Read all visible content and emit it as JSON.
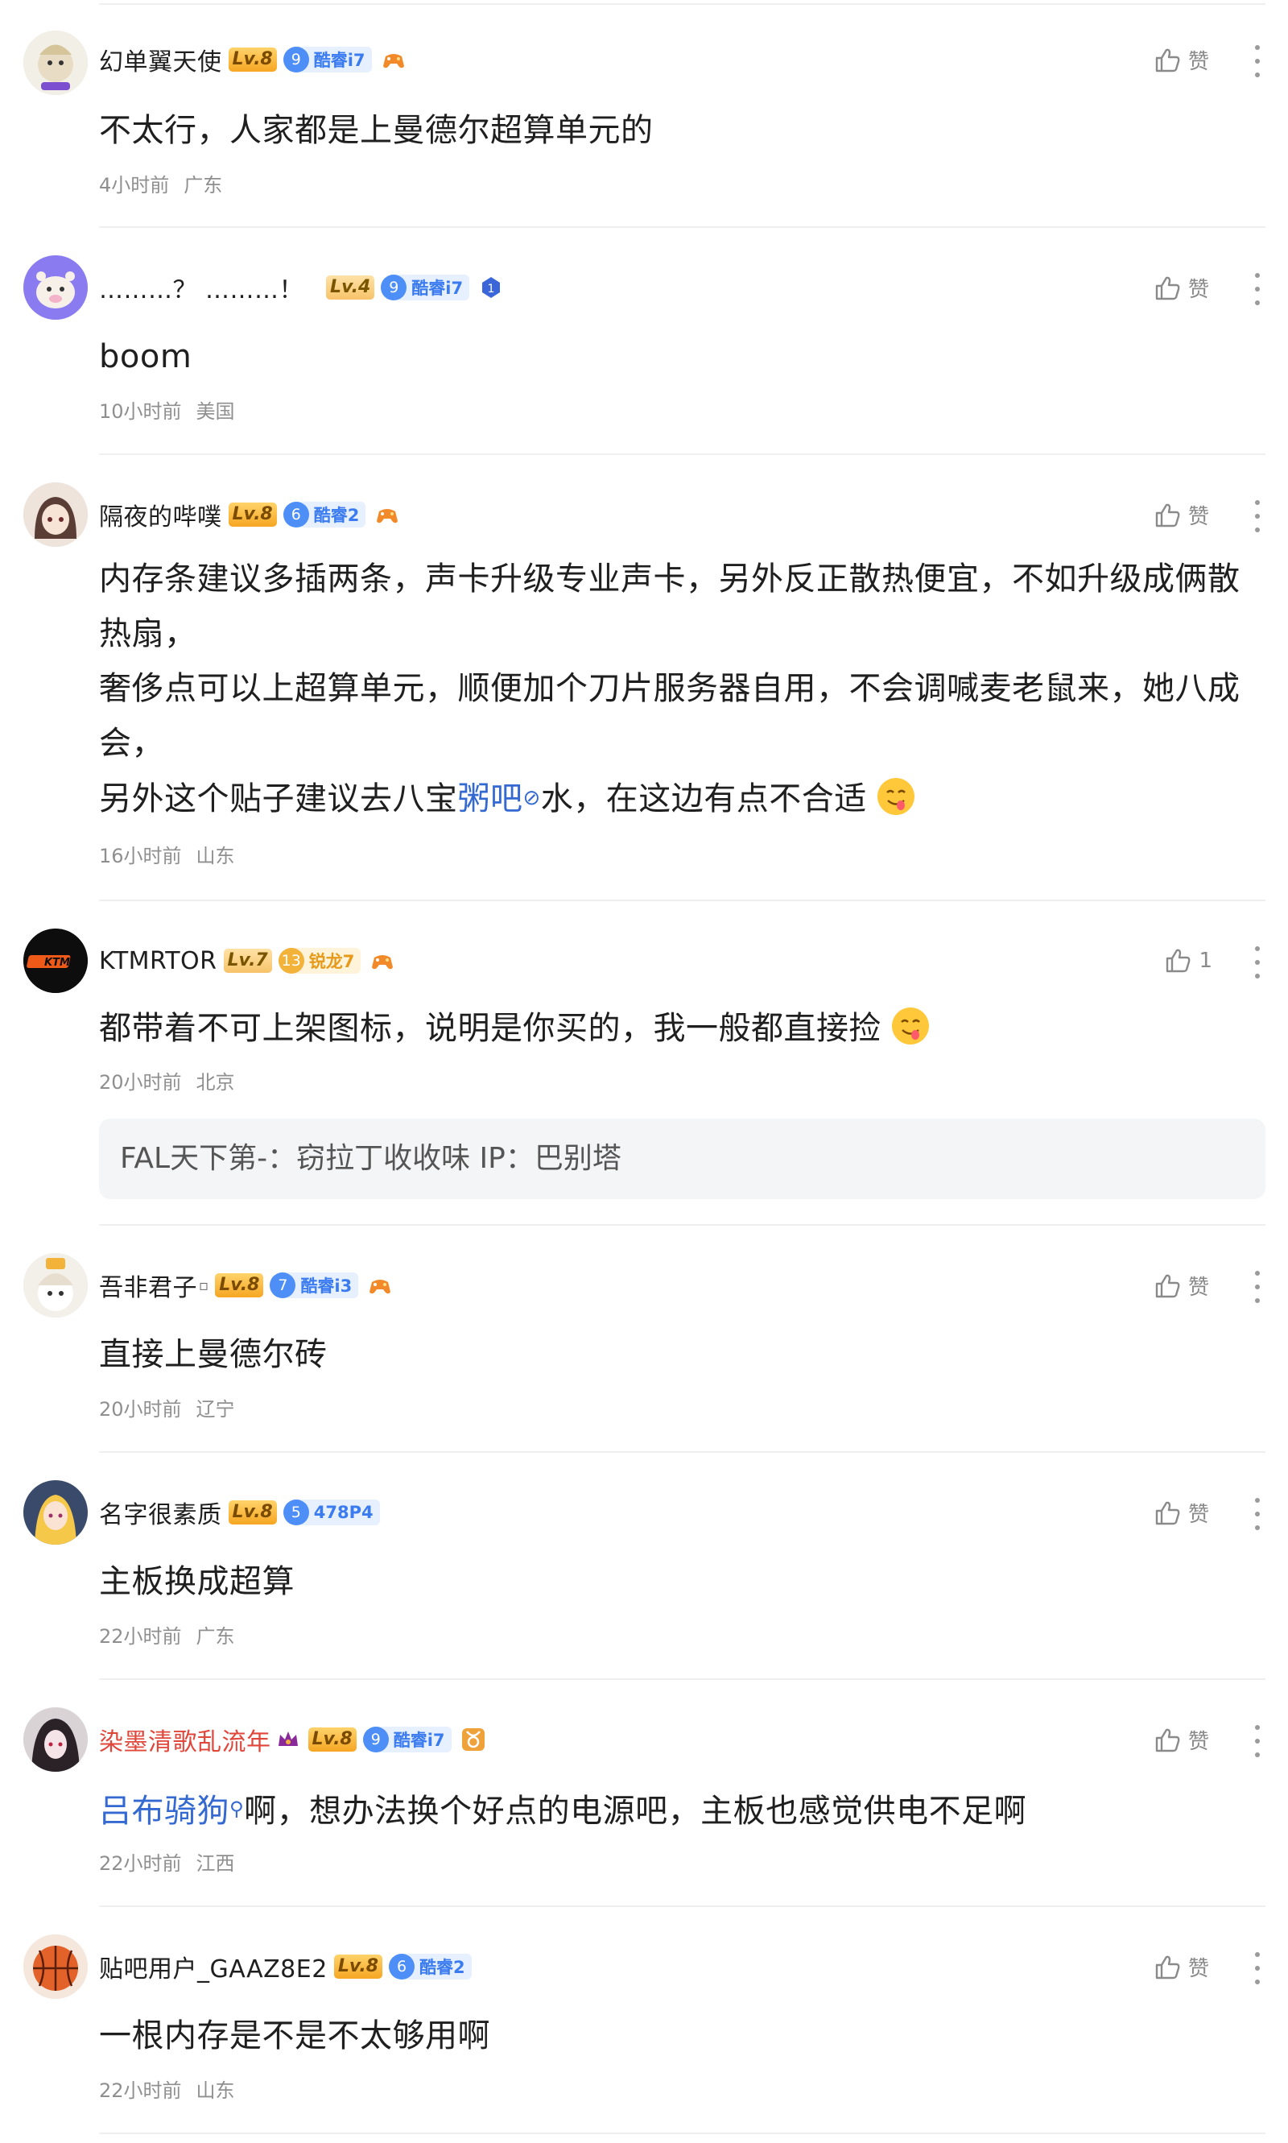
{
  "like_label": "赞",
  "comments": [
    {
      "username": "幻单翼天使",
      "level": "Lv.8",
      "tag_num": "9",
      "tag_text": "酷睿i7",
      "content": "不太行，人家都是上曼德尔超算单元的",
      "time": "4小时前",
      "location": "广东"
    },
    {
      "username": "………？ ………！",
      "level": "Lv.4",
      "tag_num": "9",
      "tag_text": "酷睿i7",
      "content": "boom",
      "time": "10小时前",
      "location": "美国"
    },
    {
      "username": "隔夜的哔噗",
      "level": "Lv.8",
      "tag_num": "6",
      "tag_text": "酷睿2",
      "content_line1": "内存条建议多插两条，声卡升级专业声卡，另外反正散热便宜，不如升级成俩散热扇，",
      "content_line2": "奢侈点可以上超算单元，顺便加个刀片服务器自用，不会调喊麦老鼠来，她八成会，",
      "content_line3_pre": "另外这个贴子建议去八宝",
      "content_line3_link": "粥吧",
      "content_line3_post": "水，在这边有点不合适",
      "time": "16小时前",
      "location": "山东"
    },
    {
      "username": "KTMRTOR",
      "level": "Lv.7",
      "tag_num": "13",
      "tag_text": "锐龙7",
      "like_count": "1",
      "content": "都带着不可上架图标，说明是你买的，我一般都直接捡",
      "time": "20小时前",
      "location": "北京",
      "reply_user": "FAL天下第-",
      "reply_text": "窃拉丁收收味 IP：巴别塔"
    },
    {
      "username": "吾非君子",
      "level": "Lv.8",
      "tag_num": "7",
      "tag_text": "酷睿i3",
      "content": "直接上曼德尔砖",
      "time": "20小时前",
      "location": "辽宁"
    },
    {
      "username": "名字很素质",
      "level": "Lv.8",
      "tag_num": "5",
      "tag_text": "478P4",
      "content": "主板换成超算",
      "time": "22小时前",
      "location": "广东"
    },
    {
      "username": "染墨清歌乱流年",
      "level": "Lv.8",
      "tag_num": "9",
      "tag_text": "酷睿i7",
      "content_mention": "吕布骑狗",
      "content": "啊，想办法换个好点的电源吧，主板也感觉供电不足啊",
      "time": "22小时前",
      "location": "江西"
    },
    {
      "username": "贴吧用户_GAAZ8E2",
      "level": "Lv.8",
      "tag_num": "6",
      "tag_text": "酷睿2",
      "content": "一根内存是不是不太够用啊",
      "time": "22小时前",
      "location": "山东"
    }
  ]
}
